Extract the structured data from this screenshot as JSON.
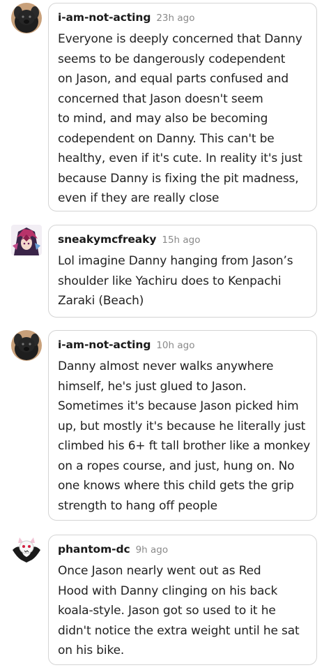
{
  "comments": [
    {
      "username": "i-am-not-acting",
      "time": "23h ago",
      "avatar": "dog-avatar",
      "lines": [
        "Everyone is deeply concerned that Danny",
        "seems to be dangerously codependent",
        "on Jason, and equal parts confused and",
        "concerned that Jason doesn't seem",
        "to mind, and may also be becoming",
        "codependent on Danny. This can't be",
        "healthy, even if it's cute. In reality it's just",
        "because Danny is fixing the pit madness,",
        "even if they are really close"
      ]
    },
    {
      "username": "sneakymcfreaky",
      "time": "15h ago",
      "avatar": "anime-character-avatar",
      "lines": [
        "Lol imagine Danny hanging from Jason’s",
        "shoulder like Yachiru does to Kenpachi",
        "Zaraki (Beach)"
      ]
    },
    {
      "username": "i-am-not-acting",
      "time": "10h ago",
      "avatar": "dog-avatar",
      "lines": [
        "Danny almost never walks anywhere",
        "himself, he's just glued to Jason.",
        "Sometimes it's because Jason picked him",
        "up, but mostly it's because he literally just",
        "climbed his 6+ ft tall brother like a monkey",
        "on a ropes course, and just, hung on. No",
        "one knows where this child gets the grip",
        "strength to hang off people"
      ]
    },
    {
      "username": "phantom-dc",
      "time": "9h ago",
      "avatar": "ghost-bat-avatar",
      "lines": [
        "Once Jason nearly went out as Red",
        "Hood with Danny clinging on his back",
        "koala-style. Jason got so used to it he",
        "didn't notice the extra weight until he sat",
        "on his bike."
      ]
    }
  ]
}
